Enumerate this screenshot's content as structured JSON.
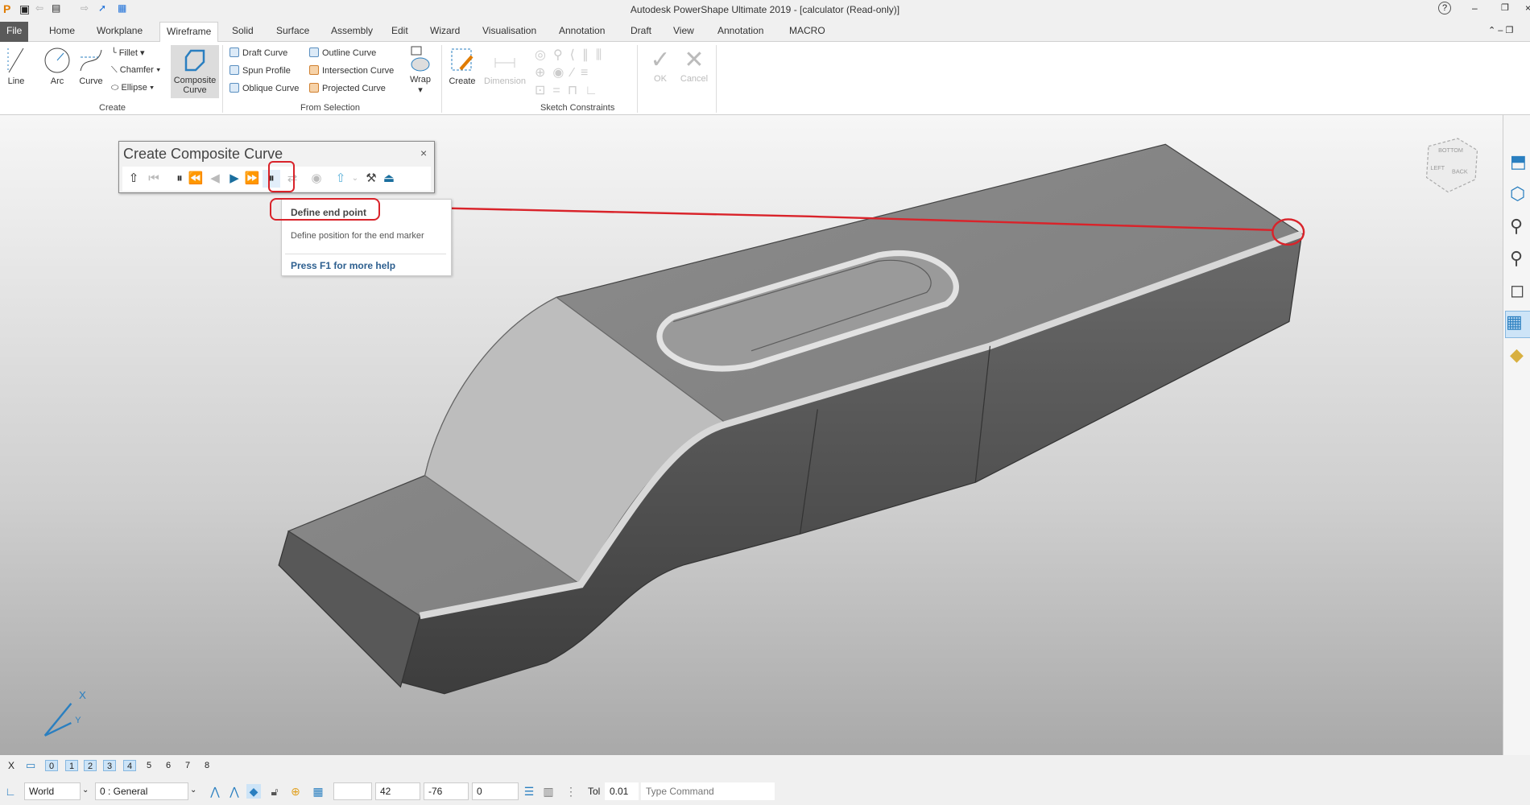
{
  "window": {
    "title": "Autodesk PowerShape Ultimate 2019 - [calculator (Read-only)]",
    "help": "?"
  },
  "tabs": [
    "File",
    "Home",
    "Workplane",
    "Wireframe",
    "Solid",
    "Surface",
    "Assembly",
    "Edit",
    "Wizard",
    "Visualisation",
    "Annotation",
    "Draft",
    "View",
    "Annotation",
    "MACRO"
  ],
  "ribbon": {
    "create": {
      "line": "Line",
      "arc": "Arc",
      "curve": "Curve",
      "fillet": "Fillet",
      "chamfer": "Chamfer",
      "ellipse": "Ellipse",
      "composite1": "Composite",
      "composite2": "Curve",
      "group": "Create"
    },
    "from_selection": {
      "draft": "Draft Curve",
      "spun": "Spun Profile",
      "oblique": "Oblique Curve",
      "outline": "Outline Curve",
      "intersection": "Intersection Curve",
      "projected": "Projected Curve",
      "wrap": "Wrap",
      "group": "From Selection"
    },
    "sketch": {
      "create": "Create",
      "dimension": "Dimension",
      "ok": "OK",
      "cancel": "Cancel",
      "group": "Sketch Constraints"
    }
  },
  "dialog": {
    "title": "Create Composite Curve",
    "close": "×"
  },
  "tooltip": {
    "title": "Define end point",
    "desc": "Define position for the end marker",
    "help": "Press F1 for more help"
  },
  "viewcube": {
    "top": "BOTTOM",
    "left": "LEFT",
    "right": "BACK"
  },
  "triad": {
    "x": "X",
    "y": "Y"
  },
  "status": {
    "close": "X",
    "layers": [
      "0",
      "1",
      "2",
      "3",
      "4",
      "5",
      "6",
      "7",
      "8"
    ],
    "active_layers": [
      0,
      1,
      2,
      3,
      4
    ],
    "workplane": "World",
    "level": "0  : General",
    "coord_x": "42",
    "coord_y": "-76",
    "coord_z": "0",
    "tol_label": "Tol",
    "tol": "0.01",
    "command_placeholder": "Type Command"
  },
  "colors": {
    "annotation": "#d9232a",
    "accent": "#2a7fc0"
  }
}
